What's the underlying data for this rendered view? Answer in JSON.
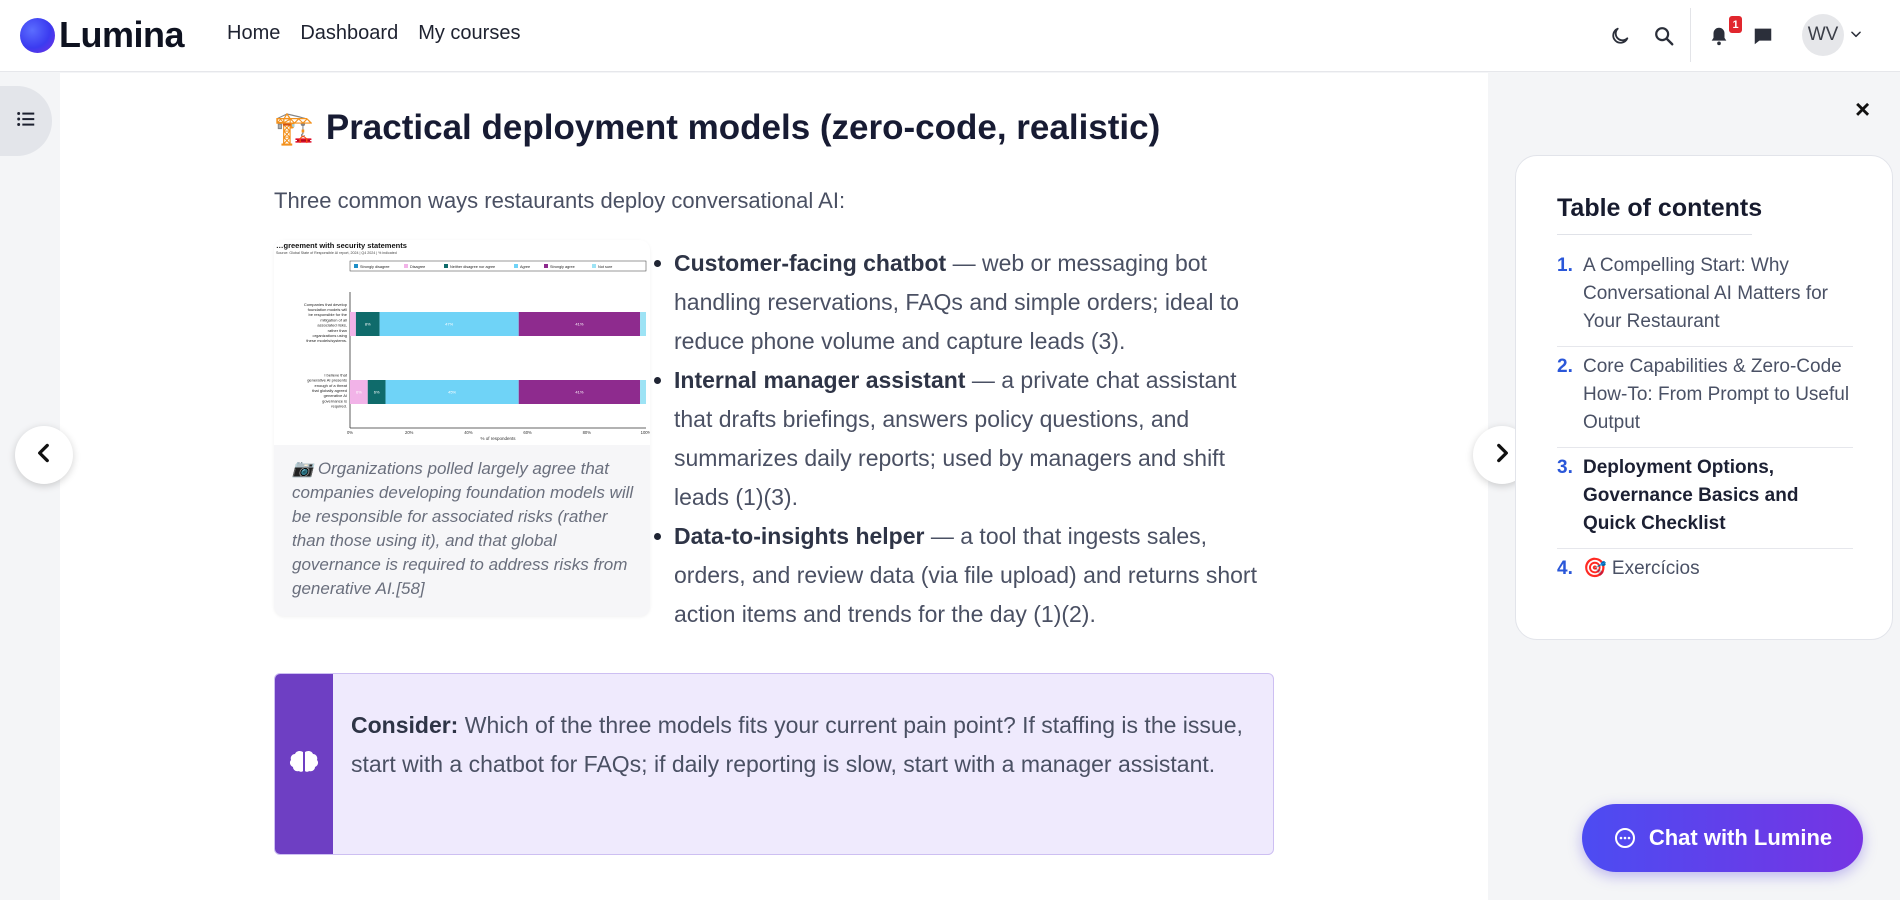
{
  "brand": {
    "name": "Lumina"
  },
  "nav": [
    "Home",
    "Dashboard",
    "My courses"
  ],
  "header": {
    "notification_count": "1",
    "avatar_initials": "WV"
  },
  "article": {
    "heading_emoji": "🏗️",
    "heading": "Practical deployment models (zero-code, realistic)",
    "intro": "Three common ways restaurants deploy conversational AI:",
    "figure": {
      "chart_title": "…greement with security statements",
      "chart_source": "Source: Global State of Responsible AI report, 2024 | Q4 2024 | % indicated",
      "caption_icon": "📷",
      "caption": "Organizations polled largely agree that companies developing foundation models will be responsible for associated risks (rather than those using it), and that global governance is required to address risks from generative AI.[58]"
    },
    "bullets": [
      {
        "title": "Customer-facing chatbot",
        "text": " — web or messaging bot handling reservations, FAQs and simple orders; ideal to reduce phone volume and capture leads (3)."
      },
      {
        "title": "Internal manager assistant",
        "text": " — a private chat assistant that drafts briefings, answers policy questions, and summarizes daily reports; used by managers and shift leads (1)(3)."
      },
      {
        "title": "Data-to-insights helper",
        "text": " — a tool that ingests sales, orders, and review data (via file upload) and returns short action items and trends for the day (1)(2)."
      }
    ],
    "callout": {
      "icon": "brain-icon",
      "label": "Consider:",
      "text": " Which of the three models fits your current pain point? If staffing is the issue, start with a chatbot for FAQs; if daily reporting is slow, start with a manager assistant."
    }
  },
  "toc": {
    "title": "Table of contents",
    "close": "×",
    "items": [
      {
        "num": "1.",
        "label": "A Compelling Start: Why Conversational AI Matters for Your Restaurant",
        "active": false
      },
      {
        "num": "2.",
        "label": "Core Capabilities & Zero-Code How-To: From Prompt to Useful Output",
        "active": false
      },
      {
        "num": "3.",
        "label": "Deployment Options, Governance Basics and Quick Checklist",
        "active": true
      },
      {
        "num": "4.",
        "label": "🎯  Exercícios",
        "active": false
      }
    ]
  },
  "chat": {
    "label": "Chat with Lumine"
  },
  "chart_data": {
    "type": "bar",
    "title": "…greement with security statements",
    "orientation": "horizontal-stacked",
    "legend": [
      "Strongly disagree",
      "Disagree",
      "Neither disagree nor agree",
      "Agree",
      "Strongly agree",
      "Not sure"
    ],
    "categories": [
      "Companies that develop foundation models will be responsible for the mitigation of all associated risks, rather than organizations using these models/systems.",
      "I believe that generative AI presents enough of a threat that globally agreed generative AI governance is required."
    ],
    "series": [
      {
        "name": "Strongly disagree",
        "values": [
          0,
          0
        ]
      },
      {
        "name": "Disagree",
        "values": [
          2,
          6
        ]
      },
      {
        "name": "Neither disagree nor agree",
        "values": [
          8,
          6
        ]
      },
      {
        "name": "Agree",
        "values": [
          47,
          45
        ]
      },
      {
        "name": "Strongly agree",
        "values": [
          41,
          41
        ]
      },
      {
        "name": "Not sure",
        "values": [
          2,
          2
        ]
      }
    ],
    "data_labels": [
      [
        "8%",
        "47%",
        "41%"
      ],
      [
        "6%",
        "6%",
        "45%",
        "41%"
      ]
    ],
    "xlabel": "% of respondents",
    "xticks": [
      "0%",
      "20%",
      "40%",
      "60%",
      "80%",
      "100%"
    ],
    "xlim": [
      0,
      100
    ],
    "colors": [
      "#1f8fc7",
      "#f2b3e8",
      "#0f6b6b",
      "#6fd3f7",
      "#8e2b8e",
      "#9de3f5"
    ]
  }
}
